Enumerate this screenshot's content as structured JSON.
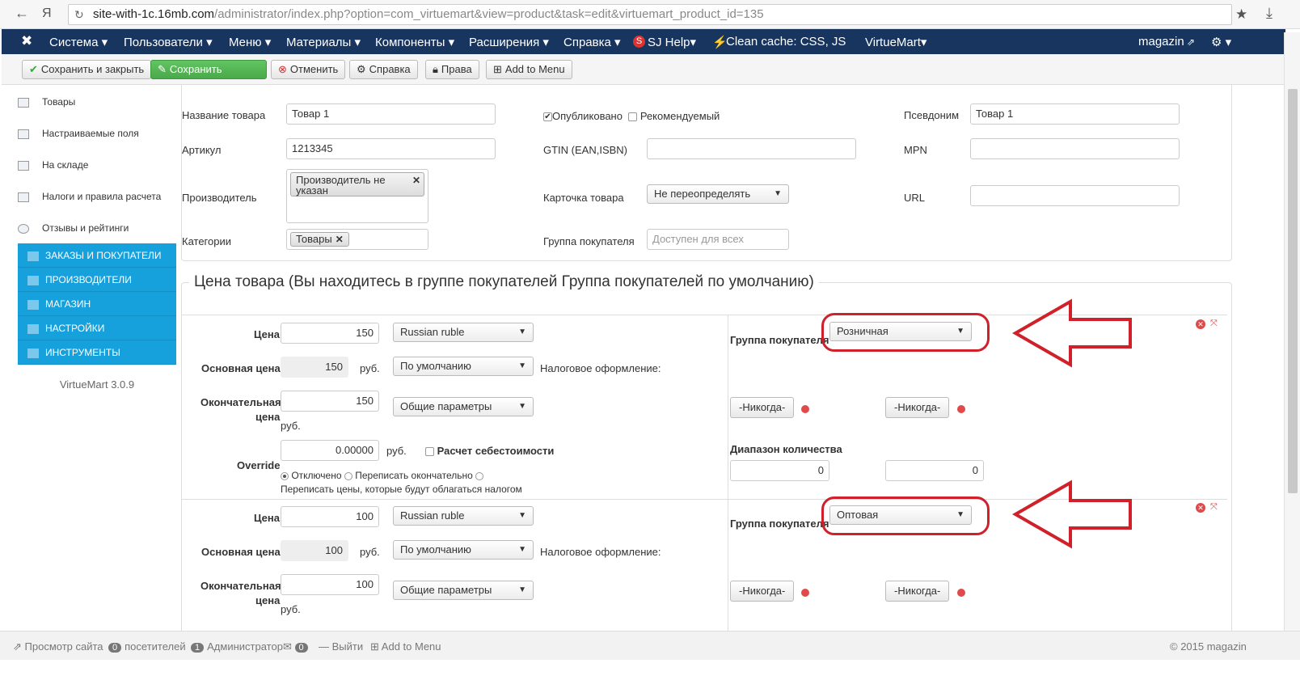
{
  "browser": {
    "url_host": "site-with-1c.16mb.com",
    "url_path": "/administrator/index.php?option=com_virtuemart&view=product&task=edit&virtuemart_product_id=135"
  },
  "topmenu": {
    "system": "Система ▾",
    "users": "Пользователи ▾",
    "menu": "Меню ▾",
    "content": "Материалы ▾",
    "components": "Компоненты ▾",
    "extensions": "Расширения ▾",
    "help": "Справка ▾",
    "sjhelp": "SJ Help▾",
    "clean": "Clean cache: CSS, JS",
    "vm": "VirtueMart▾",
    "user": "magazin",
    "gear": "⚙ ▾"
  },
  "toolbar": {
    "save_close": "Сохранить и закрыть",
    "save": "Сохранить",
    "cancel": "Отменить",
    "help": "Справка",
    "rights": "Права",
    "add_menu": "Add to Menu"
  },
  "sidebar": {
    "items": [
      {
        "label": "Товары"
      },
      {
        "label": "Настраиваемые поля"
      },
      {
        "label": "На складе"
      },
      {
        "label": "Налоги и правила расчета"
      },
      {
        "label": "Отзывы и рейтинги"
      }
    ],
    "blue_items": [
      {
        "label": "ЗАКАЗЫ И ПОКУПАТЕЛИ"
      },
      {
        "label": "ПРОИЗВОДИТЕЛИ"
      },
      {
        "label": "МАГАЗИН"
      },
      {
        "label": "НАСТРОЙКИ"
      },
      {
        "label": "ИНСТРУМЕНТЫ"
      }
    ],
    "version": "VirtueMart 3.0.9"
  },
  "product": {
    "name_label": "Название товара",
    "name_value": "Товар 1",
    "sku_label": "Артикул",
    "sku_value": "1213345",
    "mfr_label": "Производитель",
    "mfr_tag": "Производитель не указан",
    "cat_label": "Категории",
    "cat_tag": "Товары",
    "published": "Опубликовано",
    "featured": "Рекомендуемый",
    "gtin_label": "GTIN (EAN,ISBN)",
    "card_label": "Карточка товара",
    "card_value": "Не переопределять",
    "group_label": "Группа покупателя",
    "group_placeholder": "Доступен для всех",
    "alias_label": "Псевдоним",
    "alias_value": "Товар 1",
    "mpn_label": "MPN",
    "url_label": "URL"
  },
  "price_section": {
    "title": "Цена товара (Вы находитесь в группе покупателей Группа покупателей по умолчанию)"
  },
  "labels": {
    "price": "Цена",
    "base_price": "Основная цена",
    "final_price_1": "Окончательная",
    "final_price_2": "цена",
    "rub": "руб.",
    "tax": "Налоговое оформление:",
    "override": "Override",
    "cost_calc": "Расчет себестоимости",
    "off": "Отключено",
    "override_final": "Переписать окончательно",
    "override_taxed": "Переписать цены, которые будут облагаться налогом",
    "customer_group": "Группа покупателя",
    "never": "-Никогда-",
    "qty_range": "Диапазон количества",
    "currency": "Russian ruble",
    "default": "По умолчанию",
    "general": "Общие параметры"
  },
  "prices": [
    {
      "price": "150",
      "base": "150",
      "final": "150",
      "override": "0.00000",
      "group": "Розничная",
      "qty_from": "0",
      "qty_to": "0"
    },
    {
      "price": "100",
      "base": "100",
      "final": "100",
      "group": "Оптовая"
    }
  ],
  "status": {
    "view_site": "Просмотр сайта",
    "visitors_count": "0",
    "visitors": "посетителей",
    "admins_count": "1",
    "admins": "Администратор",
    "msg_count": "0",
    "logout": "Выйти",
    "add_menu": "Add to Menu",
    "copyright": "© 2015 magazin"
  },
  "colors": {
    "topbar": "#17355e",
    "sidebar_blue": "#16a0dc",
    "save_green": "#4aa94a",
    "annotation_red": "#d0202a"
  }
}
